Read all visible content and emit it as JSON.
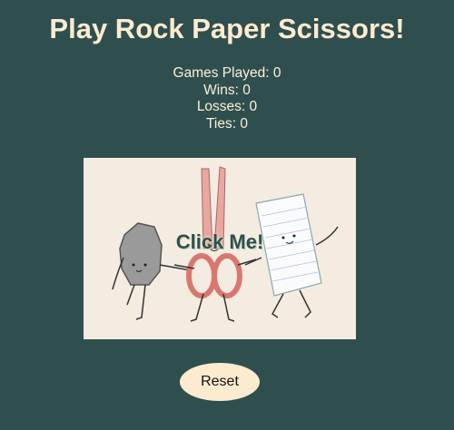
{
  "page": {
    "title": "Play Rock Paper Scissors!"
  },
  "stats": {
    "games_played": "Games Played: 0",
    "wins": "Wins: 0",
    "losses": "Losses: 0",
    "ties": "Ties: 0"
  },
  "game": {
    "click_label": "Click Me!"
  },
  "controls": {
    "reset_label": "Reset"
  },
  "colors": {
    "background": "#2f4f4e",
    "accent": "#fdebd0"
  }
}
